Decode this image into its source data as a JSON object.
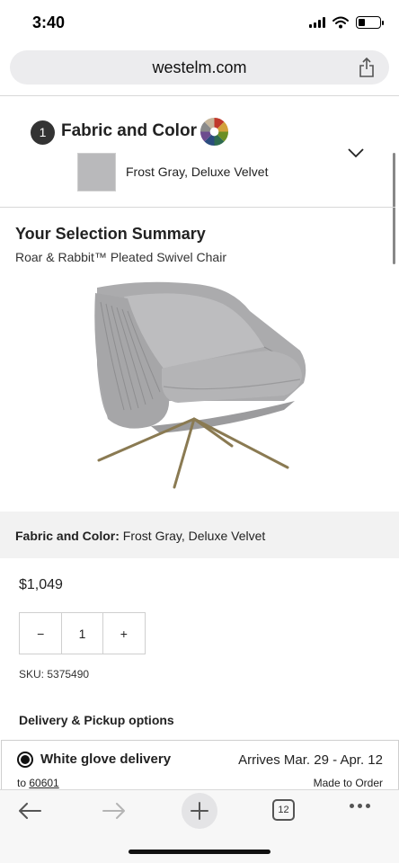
{
  "status_bar": {
    "time": "3:40",
    "battery_level": 0.3
  },
  "browser": {
    "url": "westelm.com",
    "tab_count": "12",
    "icons": [
      "share-icon",
      "back-arrow-icon",
      "forward-arrow-icon",
      "add-icon",
      "tabs-icon",
      "more-icon"
    ]
  },
  "configurator": {
    "step_number": "1",
    "step_title": "Fabric and Color",
    "selected_option": "Frost Gray, Deluxe Velvet",
    "swatch_color": "#b9b9bb",
    "expanded": false
  },
  "summary": {
    "title": "Your Selection Summary",
    "product_name": "Roar & Rabbit™ Pleated Swivel Chair",
    "fabric_label": "Fabric and Color:",
    "fabric_value": "Frost Gray, Deluxe Velvet",
    "price": "$1,049",
    "quantity": "1",
    "decrement_label": "−",
    "increment_label": "+",
    "sku": "SKU: 5375490"
  },
  "delivery": {
    "heading": "Delivery & Pickup options",
    "option_name": "White glove delivery",
    "arrives": "Arrives Mar. 29 - Apr. 12",
    "zip_prefix": "to",
    "zip": "60601",
    "made_to_order": "Made to Order",
    "selected": true
  }
}
